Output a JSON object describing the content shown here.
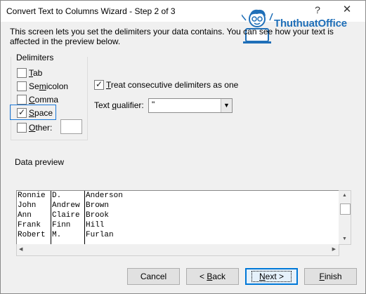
{
  "window": {
    "title": "Convert Text to Columns Wizard - Step 2 of 3",
    "help_glyph": "?",
    "close_glyph": "✕"
  },
  "description": "This screen lets you set the delimiters your data contains.  You can see how your text is affected in the preview below.",
  "watermark": {
    "text": "ThuthuatOffice"
  },
  "delimiters": {
    "label": "Delimiters",
    "items": [
      {
        "key": "tab",
        "pre": "",
        "u": "T",
        "post": "ab",
        "checked": false
      },
      {
        "key": "semicolon",
        "pre": "Se",
        "u": "m",
        "post": "icolon",
        "checked": false
      },
      {
        "key": "comma",
        "pre": "",
        "u": "C",
        "post": "omma",
        "checked": false
      },
      {
        "key": "space",
        "pre": "",
        "u": "S",
        "post": "pace",
        "checked": true
      },
      {
        "key": "other",
        "pre": "",
        "u": "O",
        "post": "ther:",
        "checked": false
      }
    ],
    "other_value": ""
  },
  "consecutive": {
    "pre": "",
    "u": "T",
    "post": "reat consecutive delimiters as one",
    "checked": true
  },
  "qualifier": {
    "pre": "Text ",
    "u": "q",
    "post": "ualifier:",
    "value": "\""
  },
  "preview": {
    "label": "Data preview",
    "columns": [
      [
        "Ronnie",
        "John",
        "Ann",
        "Frank",
        "Robert"
      ],
      [
        "D.",
        "Andrew",
        "Claire",
        "Finn",
        "M."
      ],
      [
        "Anderson",
        "Brown",
        "Brook",
        "Hill",
        "Furlan"
      ]
    ]
  },
  "buttons": {
    "cancel": {
      "pre": "Cancel",
      "u": "",
      "post": ""
    },
    "back": {
      "pre": "< ",
      "u": "B",
      "post": "ack"
    },
    "next": {
      "pre": "",
      "u": "N",
      "post": "ext >"
    },
    "finish": {
      "pre": "",
      "u": "F",
      "post": "inish"
    }
  },
  "colors": {
    "accent": "#0078d7",
    "logo": "#1f6fb8"
  }
}
